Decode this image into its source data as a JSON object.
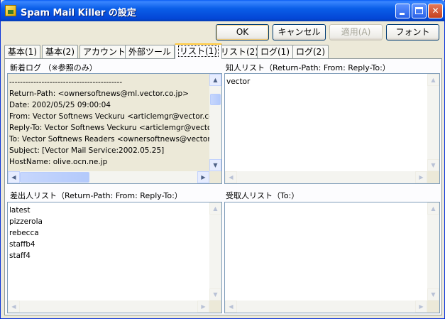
{
  "window": {
    "title": "Spam Mail Killer の設定"
  },
  "buttons": {
    "ok": "OK",
    "cancel": "キャンセル",
    "apply": "適用(A)",
    "font": "フォント"
  },
  "tabs": [
    "基本(1)",
    "基本(2)",
    "アカウント",
    "外部ツール",
    "リスト(1)",
    "リスト(2)",
    "ログ(1)",
    "ログ(2)"
  ],
  "active_tab": "リスト(1)",
  "new_log": {
    "label": "新着ログ （※参照のみ）",
    "lines": [
      "------------------------------------------",
      "Return-Path: <ownersoftnews@ml.vector.co.jp>",
      "Date: 2002/05/25 09:00:04",
      "From: Vector Softnews Veckuru <articlemgr@vector.co.j",
      "Reply-To: Vector Softnews Veckuru <articlemgr@vecto",
      "To: Vector Softnews Readers <ownersoftnews@vector.c",
      "Subject: [Vector Mail Service:2002.05.25]",
      "HostName: olive.ocn.ne.jp"
    ]
  },
  "known_list": {
    "label": "知人リスト（Return-Path: From: Reply-To:）",
    "items": [
      "vector"
    ]
  },
  "sender_list": {
    "label": "差出人リスト（Return-Path: From: Reply-To:）",
    "items": [
      "latest",
      "pizzerola",
      "rebecca",
      "staffb4",
      "staff4"
    ]
  },
  "recipient_list": {
    "label": "受取人リスト（To:）",
    "items": []
  }
}
